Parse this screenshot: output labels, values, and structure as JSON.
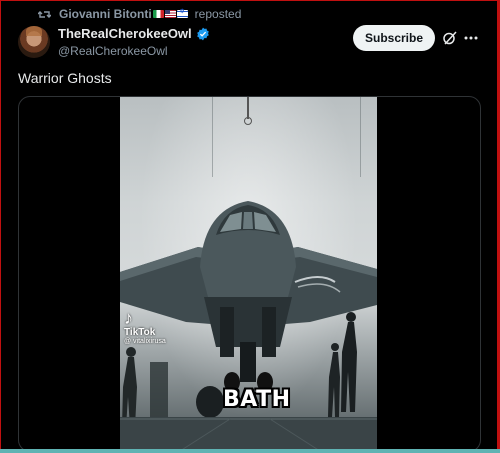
{
  "repost": {
    "user": "Giovanni Bitonti",
    "label": "reposted"
  },
  "author": {
    "display_name": "TheRealCherokeeOwl",
    "handle": "@RealCherokeeOwl"
  },
  "actions": {
    "subscribe_label": "Subscribe"
  },
  "tweet": {
    "text": "Warrior Ghosts"
  },
  "video": {
    "watermark": {
      "brand": "TikTok",
      "user": "@ vitalixirusa"
    },
    "caption": "BATH"
  },
  "colors": {
    "accent_verified": "#1d9bf0",
    "frame": "#c01010",
    "strip": "#5fb3b3"
  },
  "icons": [
    "repost-icon",
    "verified-badge-icon",
    "grok-icon",
    "more-icon",
    "tiktok-icon"
  ]
}
